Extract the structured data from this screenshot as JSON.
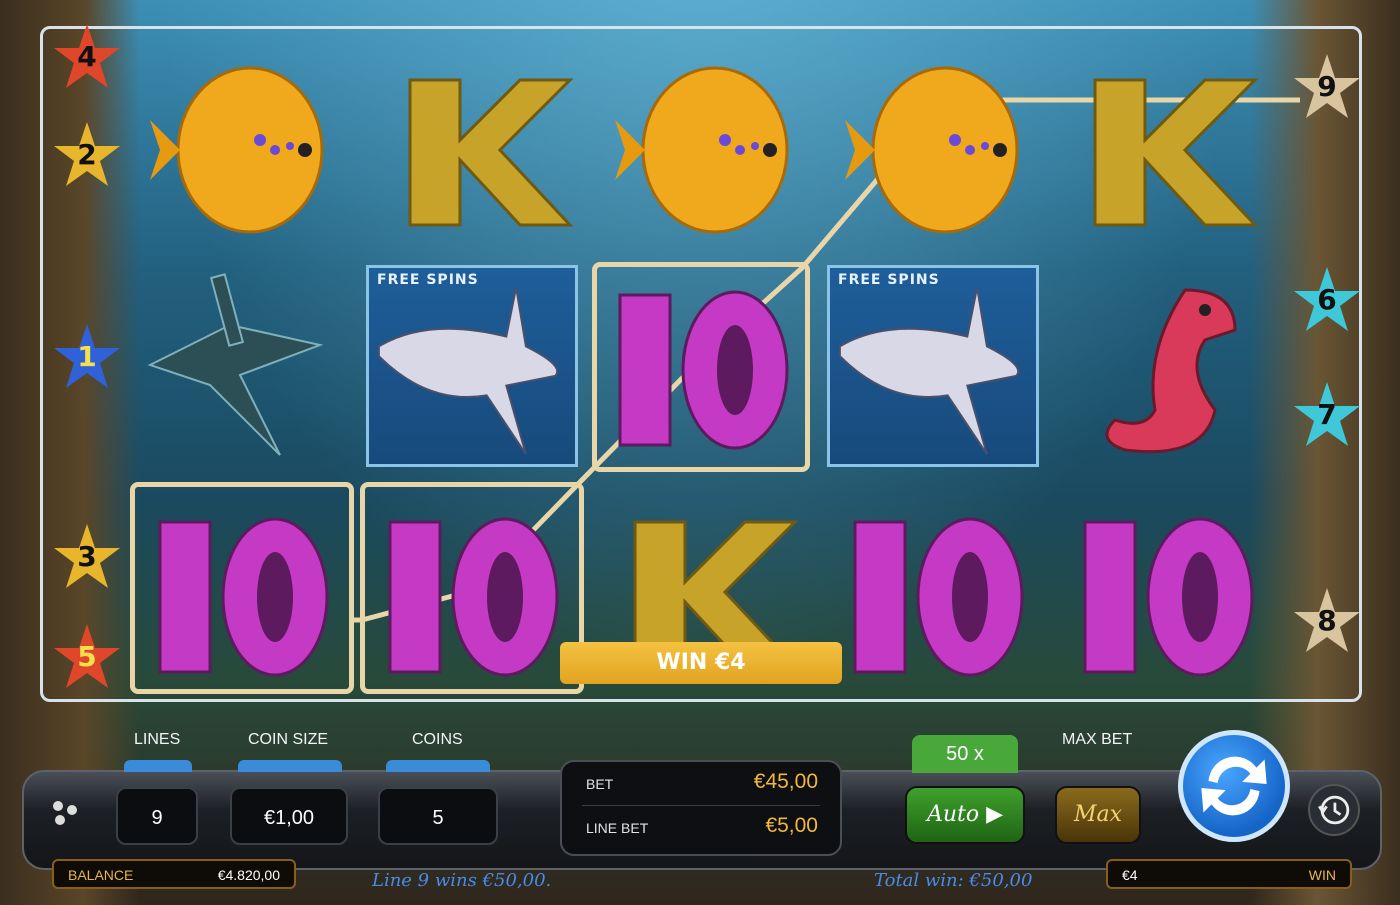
{
  "paylines": {
    "left": [
      "4",
      "2",
      "1",
      "3",
      "5"
    ],
    "right": [
      "9",
      "6",
      "7",
      "8"
    ]
  },
  "reels": {
    "free_spins_label": "FREE SPINS",
    "symbols": [
      [
        "fish",
        "k",
        "fish",
        "fish",
        "k"
      ],
      [
        "shark",
        "dolphin",
        "ten",
        "dolphin",
        "seahorse"
      ],
      [
        "ten",
        "ten",
        "k",
        "ten",
        "ten"
      ]
    ]
  },
  "win_banner": "WIN €4",
  "controls": {
    "lines_label": "LINES",
    "coin_size_label": "COIN SIZE",
    "coins_label": "COINS",
    "lines_value": "9",
    "coin_size_value": "€1,00",
    "coins_value": "5",
    "bet_label": "BET",
    "bet_value": "€45,00",
    "line_bet_label": "LINE BET",
    "line_bet_value": "€5,00",
    "multiplier": "50 x",
    "auto_label": "Auto ▶",
    "max_bet_label": "MAX BET",
    "max_label": "Max"
  },
  "footer": {
    "balance_label": "BALANCE",
    "balance_value": "€4.820,00",
    "line_message": "Line 9 wins €50,00.",
    "total_win": "Total win: €50,00",
    "win_value": "€4",
    "win_label": "WIN"
  },
  "colors": {
    "accent_gold": "#f3b73a",
    "win_frame": "#e9d6a8",
    "spin_blue": "#1565c8"
  }
}
